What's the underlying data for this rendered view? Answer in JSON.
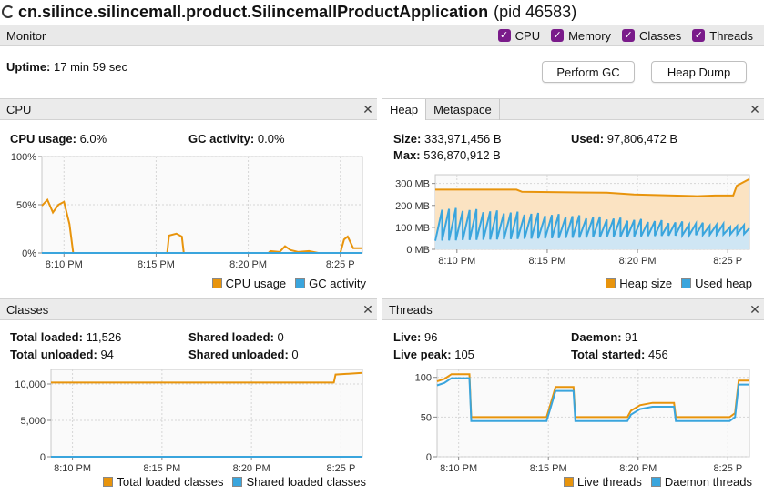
{
  "window": {
    "app_name": "cn.silince.silincemall.product.SilincemallProductApplication",
    "pid": "(pid 46583)"
  },
  "monitor": {
    "title": "Monitor",
    "checkboxes": [
      {
        "label": "CPU"
      },
      {
        "label": "Memory"
      },
      {
        "label": "Classes"
      },
      {
        "label": "Threads"
      }
    ],
    "uptime_label": "Uptime:",
    "uptime_value": "17 min 59 sec",
    "perform_gc": "Perform GC",
    "heap_dump": "Heap Dump"
  },
  "colors": {
    "orange": "#e8940c",
    "blue": "#3aa5dd",
    "orange_fill": "#fbe3c2"
  },
  "cpu": {
    "title": "CPU",
    "usage_label": "CPU usage:",
    "usage_value": "6.0%",
    "gc_label": "GC activity:",
    "gc_value": "0.0%",
    "y_ticks": [
      "100%",
      "50%",
      "0%"
    ],
    "x_ticks": [
      "8:10 PM",
      "8:15 PM",
      "8:20 PM",
      "8:25 P"
    ],
    "legend": [
      "CPU usage",
      "GC activity"
    ]
  },
  "heap": {
    "tab_heap": "Heap",
    "tab_metaspace": "Metaspace",
    "size_label": "Size:",
    "size_value": "333,971,456 B",
    "used_label": "Used:",
    "used_value": "97,806,472 B",
    "max_label": "Max:",
    "max_value": "536,870,912 B",
    "y_ticks": [
      "300 MB",
      "200 MB",
      "100 MB",
      "0 MB"
    ],
    "x_ticks": [
      "8:10 PM",
      "8:15 PM",
      "8:20 PM",
      "8:25 P"
    ],
    "legend": [
      "Heap size",
      "Used heap"
    ]
  },
  "classes": {
    "title": "Classes",
    "total_loaded_label": "Total loaded:",
    "total_loaded_value": "11,526",
    "shared_loaded_label": "Shared loaded:",
    "shared_loaded_value": "0",
    "total_unloaded_label": "Total unloaded:",
    "total_unloaded_value": "94",
    "shared_unloaded_label": "Shared unloaded:",
    "shared_unloaded_value": "0",
    "y_ticks": [
      "10,000",
      "5,000",
      "0"
    ],
    "x_ticks": [
      "8:10 PM",
      "8:15 PM",
      "8:20 PM",
      "8:25 P"
    ],
    "legend": [
      "Total loaded classes",
      "Shared loaded classes"
    ]
  },
  "threads": {
    "title": "Threads",
    "live_label": "Live:",
    "live_value": "96",
    "daemon_label": "Daemon:",
    "daemon_value": "91",
    "live_peak_label": "Live peak:",
    "live_peak_value": "105",
    "total_started_label": "Total started:",
    "total_started_value": "456",
    "y_ticks": [
      "100",
      "50",
      "0"
    ],
    "x_ticks": [
      "8:10 PM",
      "8:15 PM",
      "8:20 PM",
      "8:25 P"
    ],
    "legend": [
      "Live threads",
      "Daemon threads"
    ]
  },
  "chart_data": [
    {
      "type": "line",
      "y_unit": "%",
      "ylim": [
        0,
        100
      ],
      "xlim_min": [
        0,
        17.4
      ],
      "series": [
        {
          "name": "CPU usage",
          "points": [
            [
              0,
              49
            ],
            [
              0.3,
              55
            ],
            [
              0.6,
              42
            ],
            [
              0.9,
              50
            ],
            [
              1.2,
              53
            ],
            [
              1.5,
              30
            ],
            [
              1.7,
              0
            ],
            [
              6.8,
              0
            ],
            [
              6.9,
              18
            ],
            [
              7.3,
              20
            ],
            [
              7.6,
              17
            ],
            [
              7.7,
              0
            ],
            [
              12.3,
              0
            ],
            [
              12.4,
              2
            ],
            [
              12.9,
              1
            ],
            [
              13.2,
              7
            ],
            [
              13.5,
              3
            ],
            [
              13.9,
              1
            ],
            [
              14.5,
              2
            ],
            [
              15,
              0
            ],
            [
              16.2,
              0
            ],
            [
              16.4,
              14
            ],
            [
              16.6,
              17
            ],
            [
              16.9,
              5
            ],
            [
              17.4,
              5
            ]
          ]
        },
        {
          "name": "GC activity",
          "points": [
            [
              0,
              0
            ],
            [
              17.4,
              0
            ]
          ]
        }
      ]
    },
    {
      "type": "area",
      "y_unit": "MB",
      "ylim": [
        0,
        340
      ],
      "xlim_min": [
        0,
        17.4
      ],
      "series": [
        {
          "name": "Heap size",
          "points": [
            [
              0,
              272
            ],
            [
              4.5,
              272
            ],
            [
              4.8,
              262
            ],
            [
              9.5,
              258
            ],
            [
              11,
              250
            ],
            [
              14.5,
              242
            ],
            [
              15.5,
              245
            ],
            [
              16.5,
              245
            ],
            [
              16.7,
              290
            ],
            [
              17.4,
              320
            ]
          ]
        },
        {
          "name": "Used heap",
          "sawtooth": true,
          "points": [
            [
              0,
              180
            ],
            [
              17.4,
              95
            ]
          ]
        }
      ]
    },
    {
      "type": "line",
      "ylim": [
        0,
        12000
      ],
      "xlim_min": [
        0,
        17.4
      ],
      "series": [
        {
          "name": "Total loaded classes",
          "points": [
            [
              0,
              10200
            ],
            [
              15.8,
              10200
            ],
            [
              15.9,
              11300
            ],
            [
              17.4,
              11526
            ]
          ]
        },
        {
          "name": "Shared loaded classes",
          "points": [
            [
              0,
              0
            ],
            [
              17.4,
              0
            ]
          ]
        }
      ]
    },
    {
      "type": "line",
      "ylim": [
        0,
        110
      ],
      "xlim_min": [
        0,
        17.4
      ],
      "series": [
        {
          "name": "Live threads",
          "points": [
            [
              0,
              95
            ],
            [
              0.4,
              98
            ],
            [
              0.8,
              104
            ],
            [
              1.8,
              104
            ],
            [
              1.9,
              50
            ],
            [
              6.1,
              50
            ],
            [
              6.3,
              65
            ],
            [
              6.6,
              88
            ],
            [
              7.6,
              88
            ],
            [
              7.7,
              50
            ],
            [
              10.6,
              50
            ],
            [
              10.8,
              58
            ],
            [
              11.3,
              65
            ],
            [
              12,
              68
            ],
            [
              13.2,
              68
            ],
            [
              13.3,
              50
            ],
            [
              16.3,
              50
            ],
            [
              16.6,
              55
            ],
            [
              16.8,
              96
            ],
            [
              17.4,
              96
            ]
          ]
        },
        {
          "name": "Daemon threads",
          "points": [
            [
              0,
              90
            ],
            [
              0.4,
              93
            ],
            [
              0.8,
              99
            ],
            [
              1.8,
              99
            ],
            [
              1.9,
              45
            ],
            [
              6.1,
              45
            ],
            [
              6.3,
              60
            ],
            [
              6.6,
              83
            ],
            [
              7.6,
              83
            ],
            [
              7.7,
              45
            ],
            [
              10.6,
              45
            ],
            [
              10.8,
              53
            ],
            [
              11.3,
              60
            ],
            [
              12,
              63
            ],
            [
              13.2,
              63
            ],
            [
              13.3,
              45
            ],
            [
              16.3,
              45
            ],
            [
              16.6,
              50
            ],
            [
              16.8,
              91
            ],
            [
              17.4,
              91
            ]
          ]
        }
      ]
    }
  ]
}
